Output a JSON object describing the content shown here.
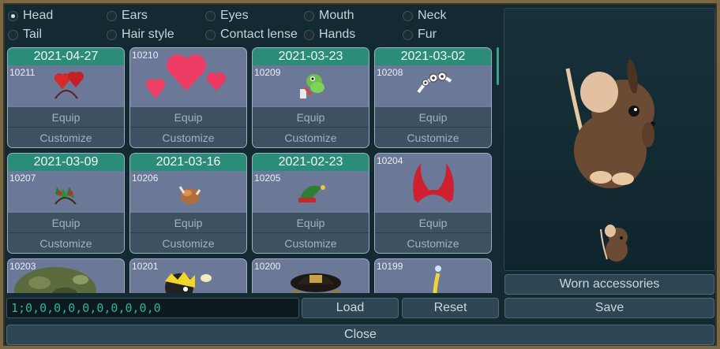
{
  "categories": [
    {
      "label": "Head",
      "selected": true
    },
    {
      "label": "Ears",
      "selected": false
    },
    {
      "label": "Eyes",
      "selected": false
    },
    {
      "label": "Mouth",
      "selected": false
    },
    {
      "label": "Neck",
      "selected": false
    },
    {
      "label": "Tail",
      "selected": false
    },
    {
      "label": "Hair style",
      "selected": false
    },
    {
      "label": "Contact lense",
      "selected": false
    },
    {
      "label": "Hands",
      "selected": false
    },
    {
      "label": "Fur",
      "selected": false
    }
  ],
  "items": [
    {
      "date": "2021-04-27",
      "id": "10211",
      "icon": "red-heart-headband-icon"
    },
    {
      "date": "",
      "id": "10210",
      "icon": "pink-hearts-icon"
    },
    {
      "date": "2021-03-23",
      "id": "10209",
      "icon": "green-dino-hat-icon"
    },
    {
      "date": "2021-03-02",
      "id": "10208",
      "icon": "white-tiara-icon"
    },
    {
      "date": "2021-03-09",
      "id": "10207",
      "icon": "holly-headband-icon"
    },
    {
      "date": "2021-03-16",
      "id": "10206",
      "icon": "roast-chicken-hat-icon"
    },
    {
      "date": "2021-02-23",
      "id": "10205",
      "icon": "green-elf-hat-icon"
    },
    {
      "date": "",
      "id": "10204",
      "icon": "red-devil-horns-icon"
    },
    {
      "date": "",
      "id": "10203",
      "icon": "camo-cap-icon"
    },
    {
      "date": "",
      "id": "10201",
      "icon": "yellow-black-hair-icon"
    },
    {
      "date": "",
      "id": "10200",
      "icon": "pirate-hat-icon"
    },
    {
      "date": "",
      "id": "10199",
      "icon": "yellow-antenna-icon"
    }
  ],
  "labels": {
    "equip": "Equip",
    "customize": "Customize",
    "worn_accessories": "Worn accessories",
    "load": "Load",
    "reset": "Reset",
    "save": "Save",
    "close": "Close"
  },
  "code_value": "1;0,0,0,0,0,0,0,0,0,0",
  "colors": {
    "date_header": "#2b8d77",
    "card_bg": "#6b7898",
    "code_text": "#2fb198"
  }
}
